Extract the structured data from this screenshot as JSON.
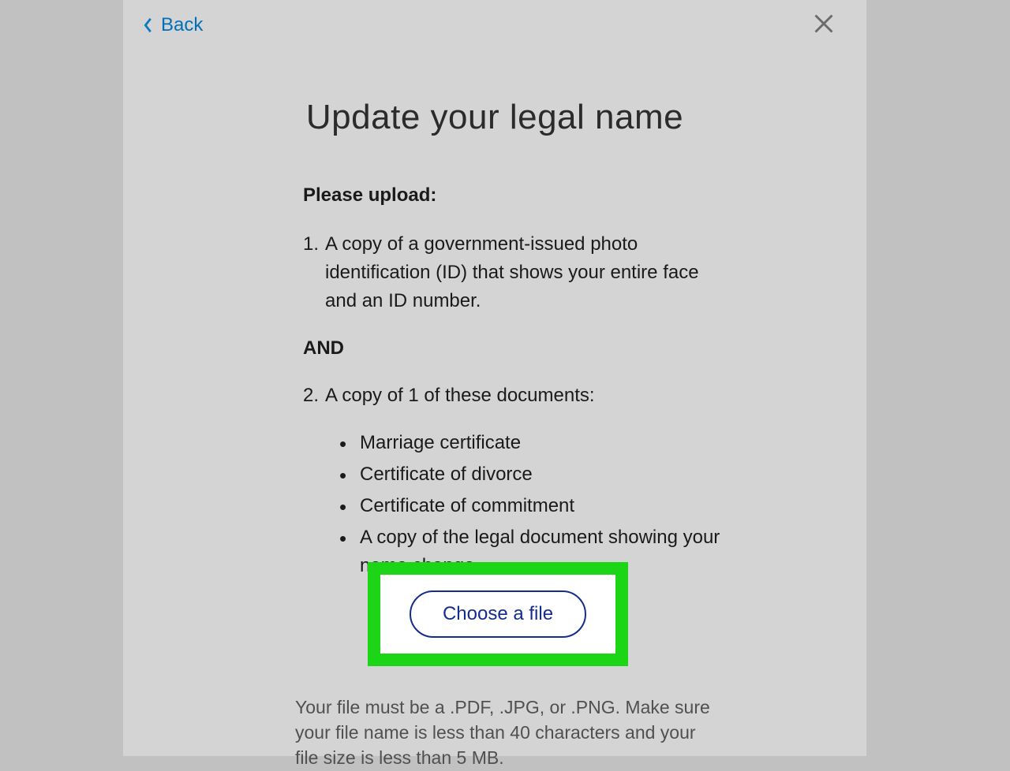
{
  "nav": {
    "back_label": "Back"
  },
  "page": {
    "title": "Update your legal name"
  },
  "upload": {
    "heading": "Please upload:",
    "item1": "A copy of a government-issued photo identification (ID) that shows your entire face and an ID number.",
    "and_label": "AND",
    "item2": "A copy of 1 of these documents:",
    "docs": {
      "a": "Marriage certificate",
      "b": "Certificate of divorce",
      "c": "Certificate of commitment",
      "d": "A copy of the legal document showing your name change"
    },
    "choose_file_label": "Choose a file",
    "file_hint": "Your file must be a .PDF, .JPG, or .PNG. Make sure your file name is less than 40 characters and your file size is less than 5 MB."
  }
}
